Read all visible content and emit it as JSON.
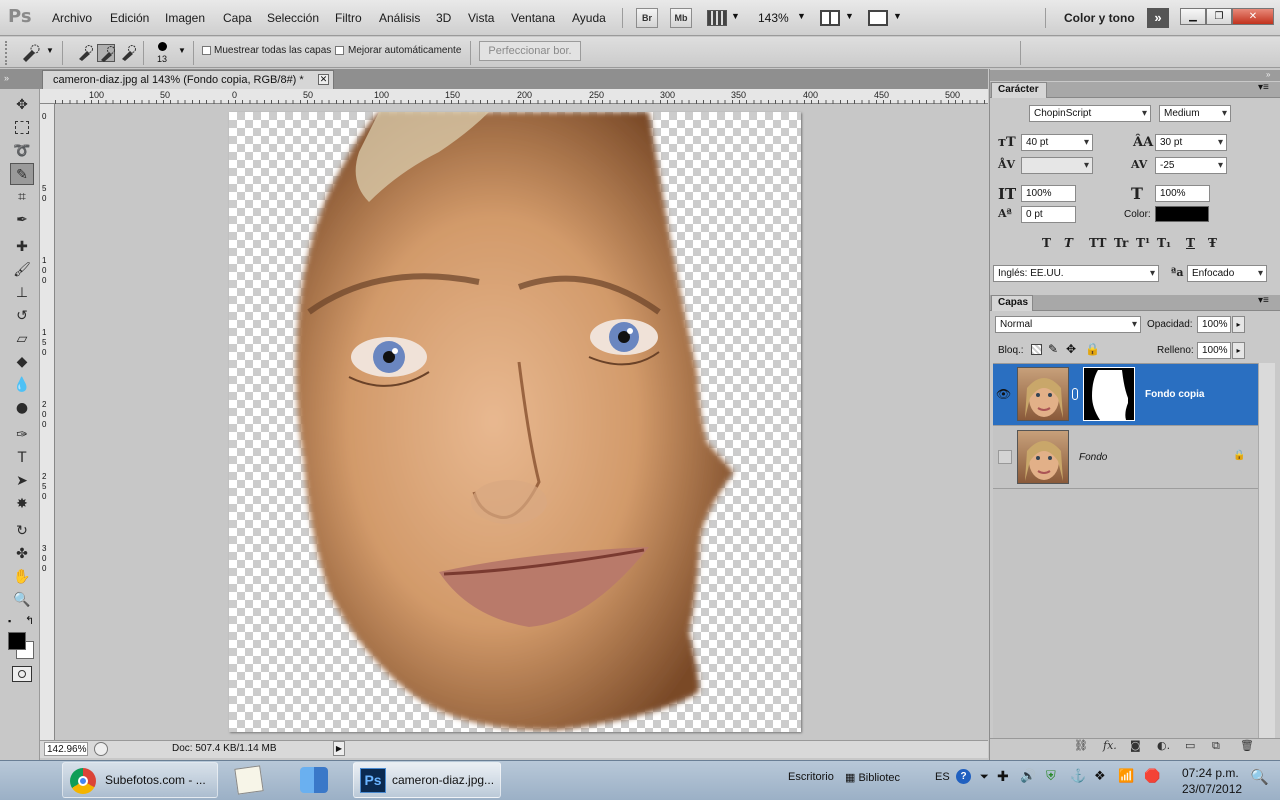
{
  "app": {
    "logo": "Ps"
  },
  "menubar": {
    "items": [
      "Archivo",
      "Edición",
      "Imagen",
      "Capa",
      "Selección",
      "Filtro",
      "Análisis",
      "3D",
      "Vista",
      "Ventana",
      "Ayuda"
    ],
    "bridge": "Br",
    "minibridge": "Mb",
    "zoom": "143%",
    "workspace": "Color y tono"
  },
  "options": {
    "brush_size": "13",
    "sample_all_layers": "Muestrear todas las capas",
    "auto_enhance": "Mejorar automáticamente",
    "refine_edge": "Perfeccionar bor."
  },
  "document": {
    "tab_title": "cameron-diaz.jpg al 143% (Fondo copia, RGB/8#) *",
    "close_glyph": "✕",
    "ruler_h": [
      "100",
      "50",
      "0",
      "50",
      "100",
      "150",
      "200",
      "250",
      "300",
      "350",
      "400",
      "450",
      "500"
    ],
    "ruler_v": [
      "0",
      "5",
      "0",
      "1",
      "0",
      "0",
      "1",
      "5",
      "0",
      "2",
      "0",
      "0",
      "2",
      "5",
      "0",
      "3",
      "0",
      "0",
      "3",
      "5",
      "0"
    ],
    "zoom_status": "142.96%",
    "doc_info": "Doc: 507.4 KB/1.14 MB"
  },
  "character_panel": {
    "tab": "Carácter",
    "font_family": "ChopinScript",
    "font_style": "Medium",
    "font_size": "40 pt",
    "leading": "30 pt",
    "kerning": "",
    "tracking": "-25",
    "vertical_scale": "100%",
    "horizontal_scale": "100%",
    "baseline_shift": "0 pt",
    "color_label": "Color:",
    "text_color": "#000000",
    "style_buttons": [
      "T",
      "T",
      "TT",
      "Tr",
      "T¹",
      "T₁",
      "T",
      "Ŧ"
    ],
    "language": "Inglés: EE.UU.",
    "antialias_label": "ªa",
    "antialias": "Enfocado"
  },
  "layers_panel": {
    "tab": "Capas",
    "blend_mode": "Normal",
    "opacity_label": "Opacidad:",
    "opacity": "100%",
    "lock_label": "Bloq.:",
    "fill_label": "Relleno:",
    "fill": "100%",
    "layers": [
      {
        "name": "Fondo copia",
        "selected": true,
        "visible": true
      },
      {
        "name": "Fondo",
        "selected": false,
        "visible": false,
        "locked": true
      }
    ],
    "selected_color": "#2a6fc1"
  },
  "taskbar": {
    "tasks": [
      "Subefotos.com - ...",
      "cameron-diaz.jpg..."
    ],
    "desktop": "Escritorio",
    "library": "Bibliotec",
    "language": "ES",
    "time": "07:24 p.m.",
    "date": "23/07/2012"
  }
}
